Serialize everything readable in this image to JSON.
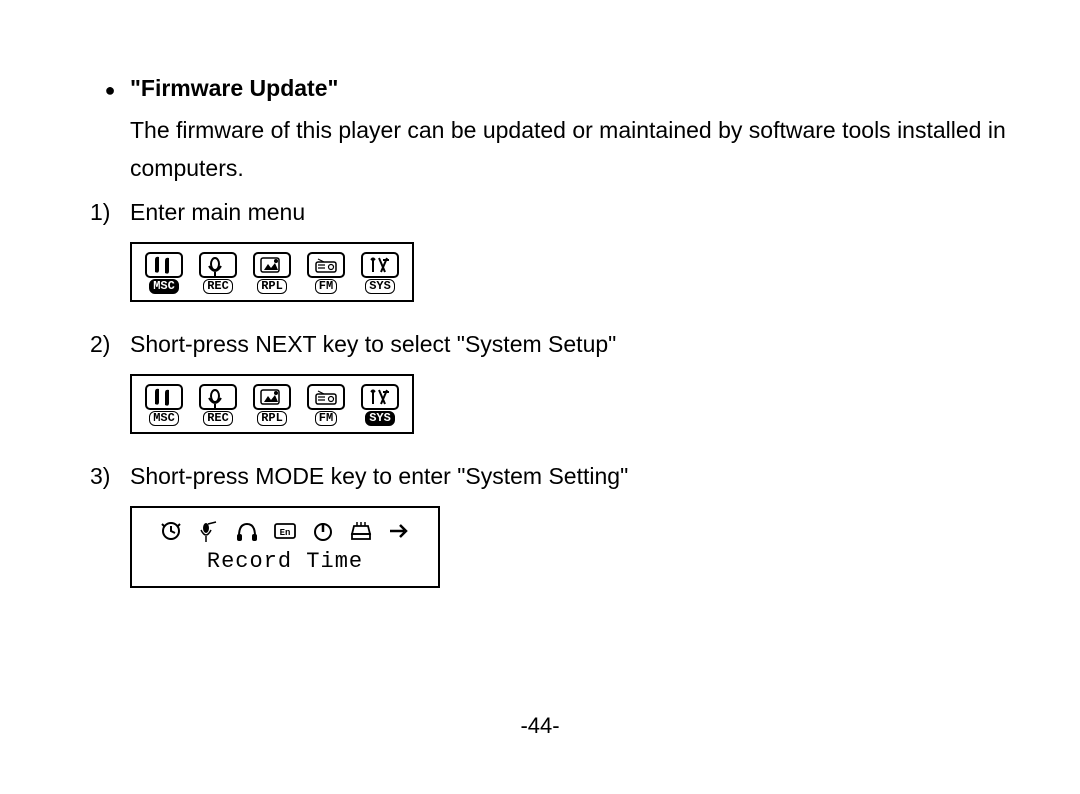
{
  "title": "\"Firmware Update\"",
  "intro": "The firmware of this player can be updated or maintained by software tools installed in computers.",
  "steps": [
    {
      "marker": "1)",
      "text": "Enter main menu"
    },
    {
      "marker": "2)",
      "text": "Short-press NEXT key to select \"System Setup\""
    },
    {
      "marker": "3)",
      "text": "Short-press MODE key to enter \"System Setting\""
    }
  ],
  "menu_labels": [
    "MSC",
    "REC",
    "RPL",
    "FM",
    "SYS"
  ],
  "screen3_caption": "Record Time",
  "page_number": "-44-"
}
